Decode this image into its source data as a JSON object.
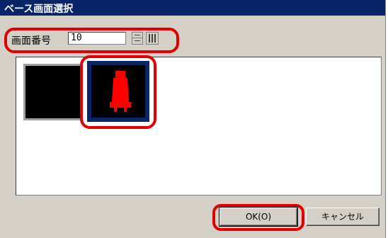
{
  "dialog": {
    "title": "ベース画面選択"
  },
  "screen": {
    "label": "画面番号",
    "value": "10"
  },
  "spinner": {
    "up_icon": "spin-up-icon",
    "down_icon": "spin-down-icon",
    "keypad_icon": "keypad-icon"
  },
  "thumbnails": [
    {
      "name": "screen-thumbnail-1",
      "content": "blank-black"
    },
    {
      "name": "screen-thumbnail-2",
      "content": "red-shape",
      "selected": true
    }
  ],
  "buttons": {
    "ok": "OK(O)",
    "cancel": "キャンセル"
  },
  "colors": {
    "highlight": "#e00000",
    "selection": "#0a246a",
    "thumbnail_bg": "#000000",
    "shape": "#ff0000"
  }
}
